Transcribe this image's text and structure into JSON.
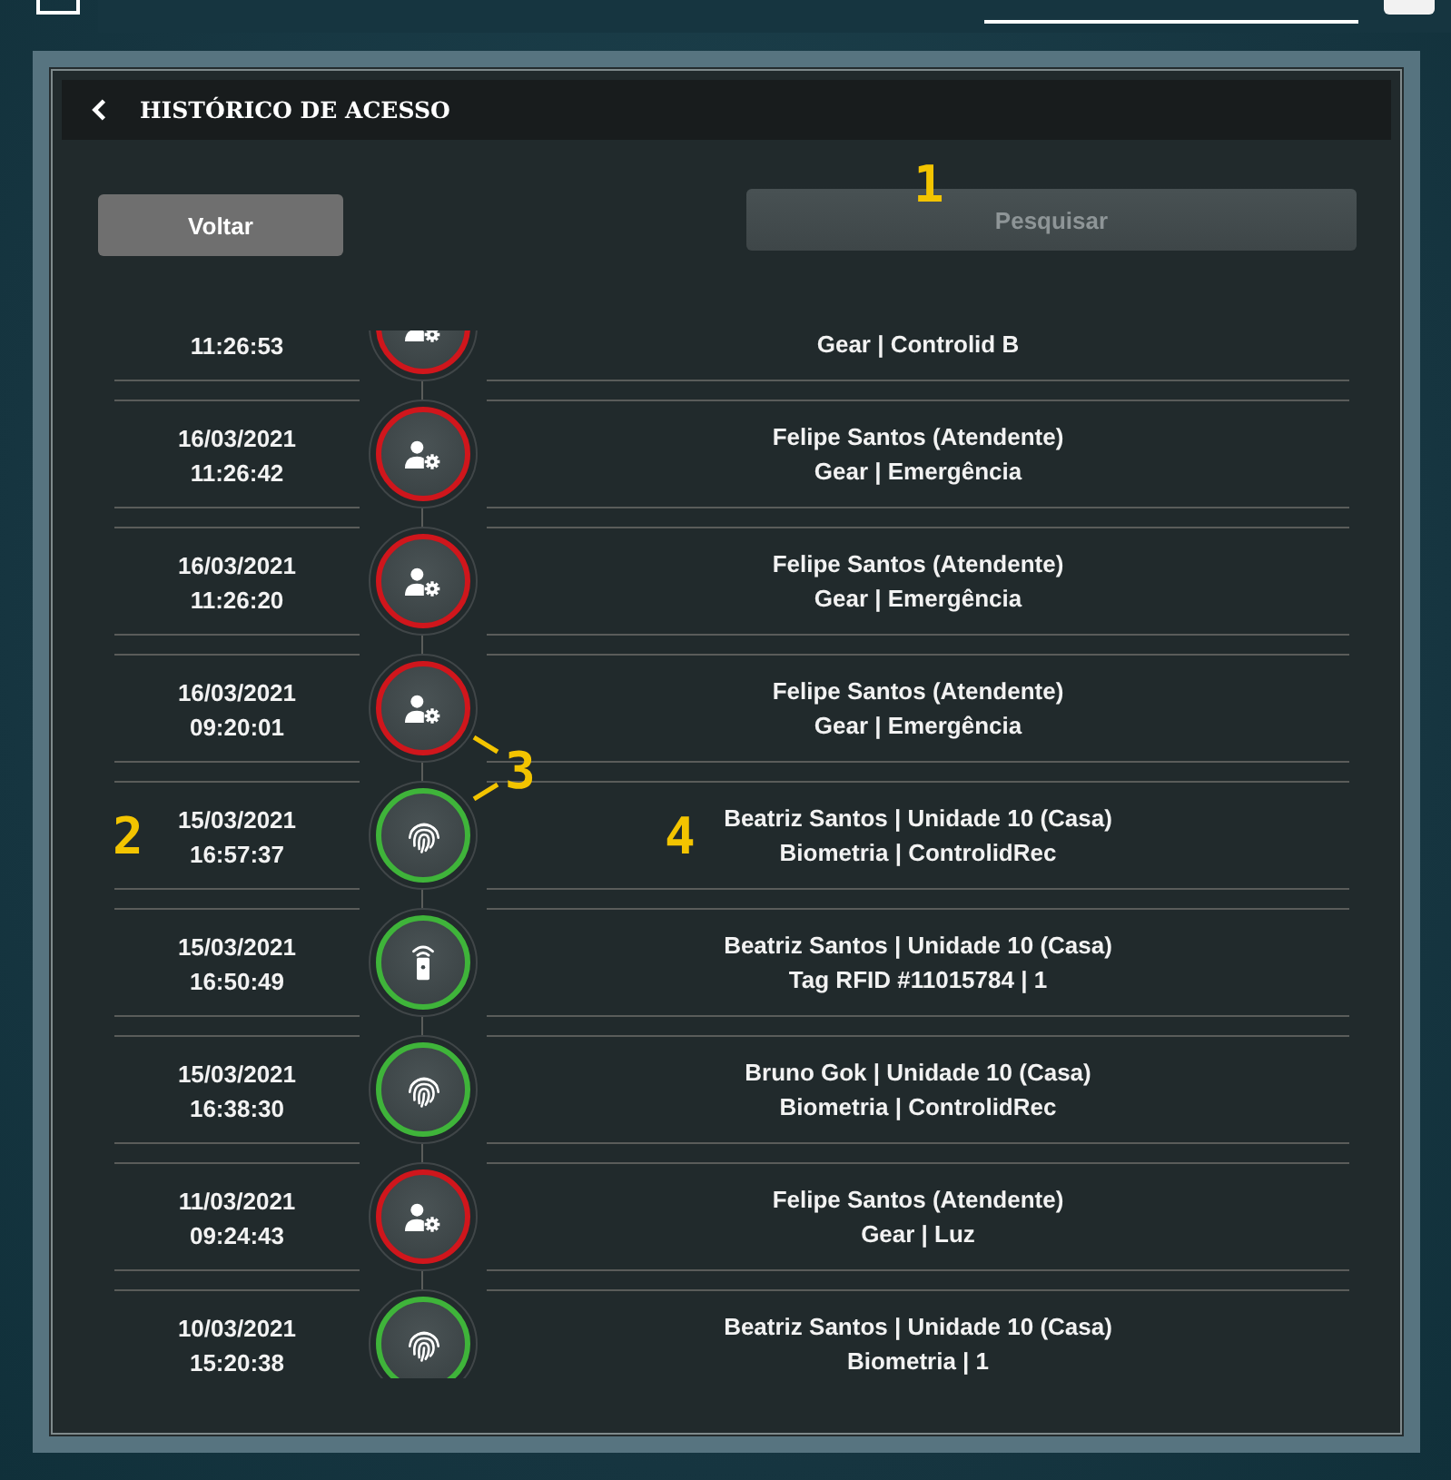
{
  "header": {
    "title": "HISTÓRICO DE ACESSO"
  },
  "buttons": {
    "back": {
      "label": "Voltar"
    },
    "search": {
      "label": "Pesquisar",
      "disabled": true
    }
  },
  "events": [
    {
      "time": "11:26:53",
      "line2": "Gear | Controlid B",
      "kind": "gear",
      "color": "#d0161c"
    },
    {
      "date": "16/03/2021",
      "time": "11:26:42",
      "line1": "Felipe Santos (Atendente)",
      "line2": "Gear | Emergência",
      "kind": "gear",
      "color": "#d0161c"
    },
    {
      "date": "16/03/2021",
      "time": "11:26:20",
      "line1": "Felipe Santos (Atendente)",
      "line2": "Gear | Emergência",
      "kind": "gear",
      "color": "#d0161c"
    },
    {
      "date": "16/03/2021",
      "time": "09:20:01",
      "line1": "Felipe Santos (Atendente)",
      "line2": "Gear | Emergência",
      "kind": "gear",
      "color": "#d0161c"
    },
    {
      "date": "15/03/2021",
      "time": "16:57:37",
      "line1": "Beatriz Santos | Unidade 10 (Casa)",
      "line2": "Biometria | ControlidRec",
      "kind": "biometric",
      "color": "#3fb43a"
    },
    {
      "date": "15/03/2021",
      "time": "16:50:49",
      "line1": "Beatriz Santos | Unidade 10 (Casa)",
      "line2": "Tag RFID #11015784 | 1",
      "kind": "rfid",
      "color": "#3fb43a"
    },
    {
      "date": "15/03/2021",
      "time": "16:38:30",
      "line1": "Bruno Gok | Unidade 10 (Casa)",
      "line2": "Biometria | ControlidRec",
      "kind": "biometric",
      "color": "#3fb43a"
    },
    {
      "date": "11/03/2021",
      "time": "09:24:43",
      "line1": "Felipe Santos (Atendente)",
      "line2": "Gear | Luz",
      "kind": "gear",
      "color": "#d0161c"
    },
    {
      "date": "10/03/2021",
      "time": "15:20:38",
      "line1": "Beatriz Santos | Unidade 10 (Casa)",
      "line2": "Biometria | 1",
      "kind": "biometric",
      "color": "#3fb43a"
    }
  ],
  "annotations": [
    "1",
    "2",
    "3",
    "4"
  ]
}
